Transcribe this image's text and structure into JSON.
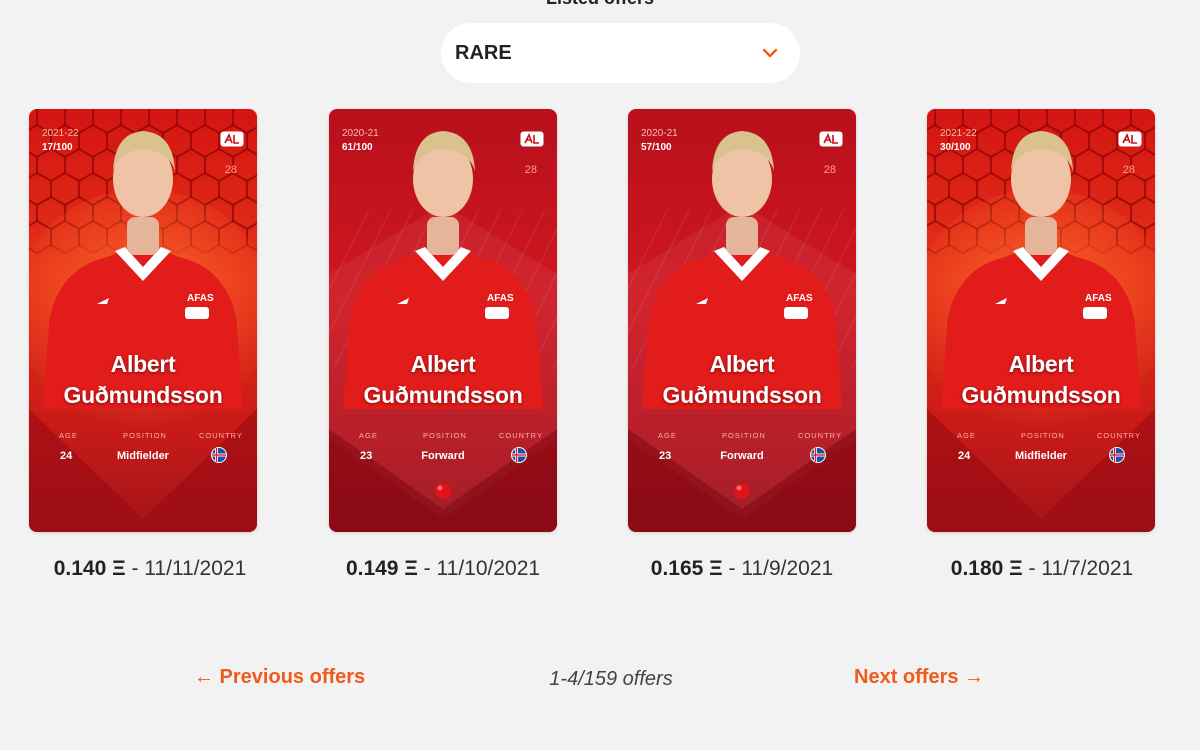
{
  "section": {
    "title": "Listed offers"
  },
  "dropdown": {
    "value": "RARE",
    "icon": "chevron-down-icon"
  },
  "labels": {
    "age": "AGE",
    "position": "POSITION",
    "country": "COUNTRY"
  },
  "colors": {
    "accent": "#f05a1a",
    "card_red": "#d31512"
  },
  "cards": [
    {
      "season": "2021-22",
      "serial": "17/100",
      "shirt": "28",
      "first_name": "Albert",
      "last_name": "Guðmundsson",
      "age": "24",
      "position": "Midfielder",
      "price": "0.140 Ξ",
      "date": "11/11/2021"
    },
    {
      "season": "2020-21",
      "serial": "61/100",
      "shirt": "28",
      "first_name": "Albert",
      "last_name": "Guðmundsson",
      "age": "23",
      "position": "Forward",
      "price": "0.149 Ξ",
      "date": "11/10/2021"
    },
    {
      "season": "2020-21",
      "serial": "57/100",
      "shirt": "28",
      "first_name": "Albert",
      "last_name": "Guðmundsson",
      "age": "23",
      "position": "Forward",
      "price": "0.165 Ξ",
      "date": "11/9/2021"
    },
    {
      "season": "2021-22",
      "serial": "30/100",
      "shirt": "28",
      "first_name": "Albert",
      "last_name": "Guðmundsson",
      "age": "24",
      "position": "Midfielder",
      "price": "0.180 Ξ",
      "date": "11/7/2021"
    }
  ],
  "pager": {
    "previous_label": "← Previous offers",
    "count_label": "1-4/159 offers",
    "next_label": "Next offers →"
  }
}
